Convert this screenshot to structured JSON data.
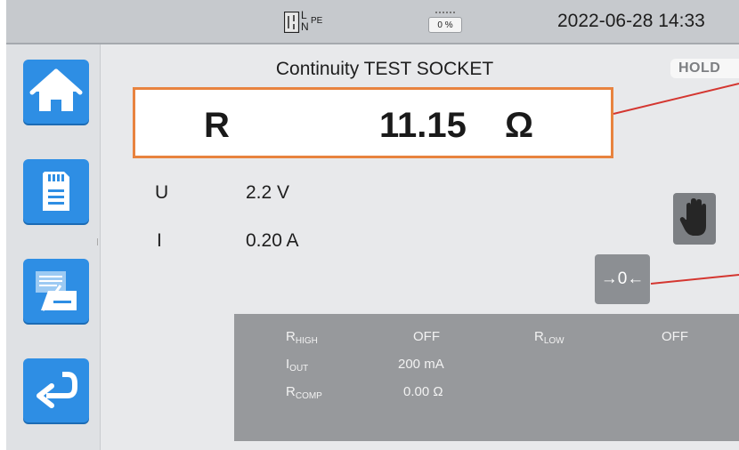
{
  "status": {
    "supply_icon": "L-N-PE-supply-icon",
    "supply_label_l": "L",
    "supply_label_n": "N",
    "supply_label_pe": "PE",
    "battery_percent": "0 %",
    "datetime": "2022-06-28   14:33"
  },
  "sidebar": {
    "items": [
      {
        "icon": "home-icon"
      },
      {
        "icon": "sd-card-icon"
      },
      {
        "icon": "data-record-icon"
      },
      {
        "icon": "back-arrow-icon"
      }
    ]
  },
  "test": {
    "title": "Continuity TEST SOCKET",
    "hold": "HOLD",
    "main_label": "R",
    "main_value": "11.15",
    "main_unit": "Ω"
  },
  "measurements": [
    {
      "label": "U",
      "value": "2.2 V"
    },
    {
      "label": "I",
      "value": "0.20 A"
    }
  ],
  "buttons": {
    "stop_icon": "hand-stop-icon",
    "zero_label": "→0←"
  },
  "settings": {
    "r_high": {
      "base": "R",
      "sub": "HIGH",
      "value": "OFF"
    },
    "r_low": {
      "base": "R",
      "sub": "LOW",
      "value": "OFF"
    },
    "i_out": {
      "base": "I",
      "sub": "OUT",
      "value": "200 mA"
    },
    "r_comp": {
      "base": "R",
      "sub": "COMP",
      "value": "0.00 Ω"
    }
  },
  "colors": {
    "accent_blue": "#2e8ee4",
    "result_border": "#e8833f",
    "callout_line": "#d43630"
  }
}
